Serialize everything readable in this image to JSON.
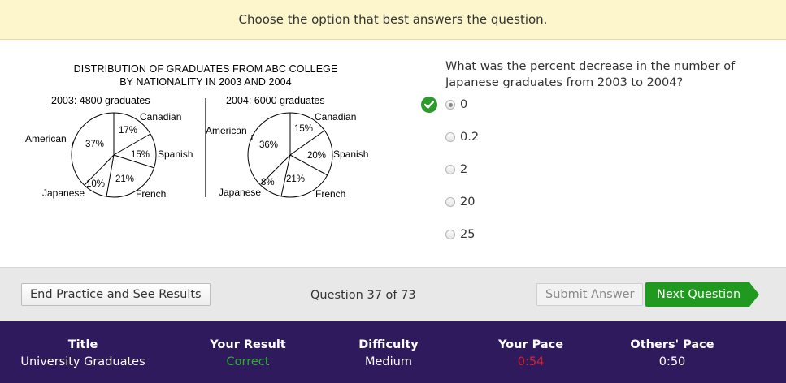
{
  "instructions": "Choose the option that best answers the question.",
  "figure": {
    "title_line1": "DISTRIBUTION OF GRADUATES FROM ABC COLLEGE",
    "title_line2": "BY NATIONALITY IN 2003 AND 2004",
    "left": {
      "year": "2003",
      "suffix": ": 4800 graduates",
      "labels": {
        "canadian": "Canadian",
        "spanish": "Spanish",
        "french": "French",
        "japanese": "Japanese",
        "american": "American"
      },
      "percents": {
        "canadian": "17%",
        "spanish": "15%",
        "french": "21%",
        "japanese": "10%",
        "american": "37%"
      }
    },
    "right": {
      "year": "2004",
      "suffix": ": 6000 graduates",
      "labels": {
        "canadian": "Canadian",
        "spanish": "Spanish",
        "french": "French",
        "japanese": "Japanese",
        "american": "American"
      },
      "percents": {
        "canadian": "15%",
        "spanish": "20%",
        "french": "21%",
        "japanese": "8%",
        "american": "36%"
      }
    }
  },
  "question": "What was the percent decrease in the number of Japanese graduates from 2003 to 2004?",
  "choices": [
    "0",
    "0.2",
    "2",
    "20",
    "25"
  ],
  "selected_choice": "0",
  "buttons": {
    "end": "End Practice and See Results",
    "submit": "Submit Answer",
    "next": "Next Question"
  },
  "counter": "Question 37 of 73",
  "stats": {
    "title": {
      "label": "Title",
      "value": "University Graduates"
    },
    "result": {
      "label": "Your Result",
      "value": "Correct"
    },
    "difficulty": {
      "label": "Difficulty",
      "value": "Medium"
    },
    "pace": {
      "label": "Your Pace",
      "value": "0:54"
    },
    "others": {
      "label": "Others' Pace",
      "value": "0:50"
    }
  },
  "colors": {
    "correct": "#2fae2f",
    "slow": "#d9242a",
    "next": "#1f9a1f",
    "stats_bg": "#2f1a5e"
  }
}
